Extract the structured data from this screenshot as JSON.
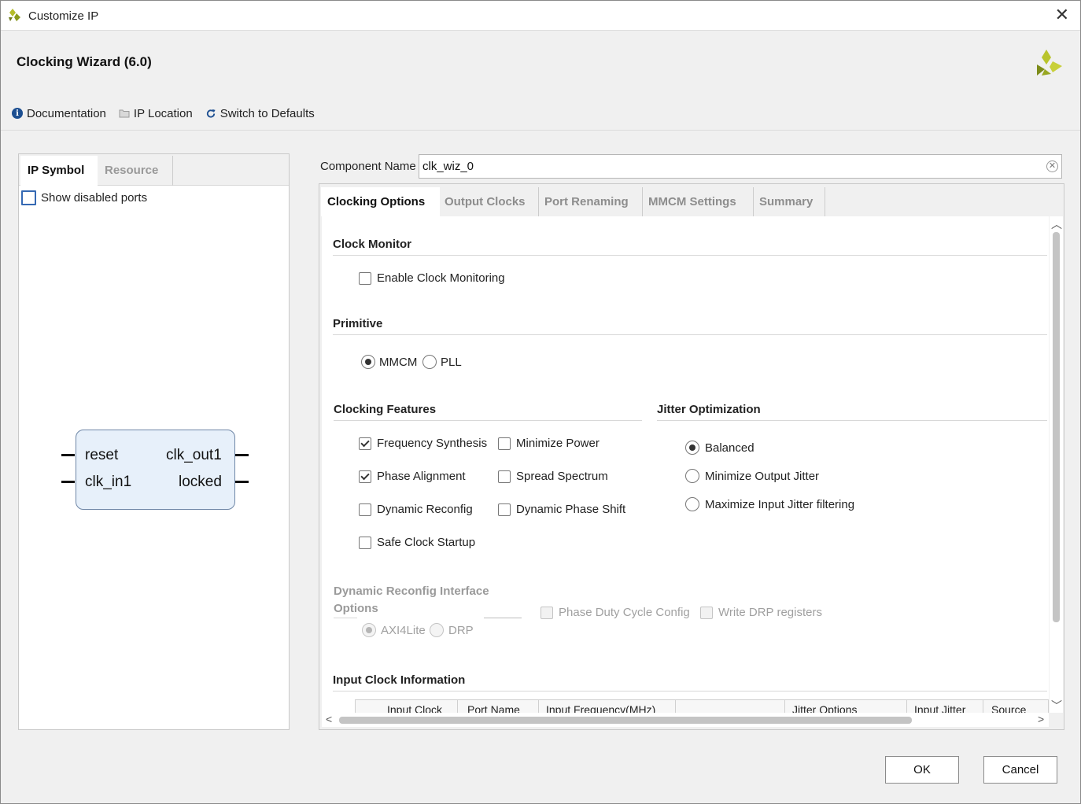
{
  "window": {
    "title": "Customize IP",
    "close_glyph": "✕"
  },
  "header": {
    "wizard_title": "Clocking Wizard (6.0)",
    "toolbar": [
      {
        "label": "Documentation",
        "icon": "info-icon"
      },
      {
        "label": "IP Location",
        "icon": "folder-icon"
      },
      {
        "label": "Switch to Defaults",
        "icon": "refresh-icon"
      }
    ]
  },
  "left_panel": {
    "tabs": [
      "IP Symbol",
      "Resource"
    ],
    "active_tab": "IP Symbol",
    "show_disabled_ports": {
      "label": "Show disabled ports",
      "checked": false
    },
    "symbol": {
      "inputs": [
        "reset",
        "clk_in1"
      ],
      "outputs": [
        "clk_out1",
        "locked"
      ]
    }
  },
  "component": {
    "label": "Component Name",
    "value": "clk_wiz_0"
  },
  "tabs": [
    "Clocking Options",
    "Output Clocks",
    "Port Renaming",
    "MMCM Settings",
    "Summary"
  ],
  "active_tab": "Clocking Options",
  "clock_monitor": {
    "title": "Clock Monitor",
    "enable": {
      "label": "Enable Clock Monitoring",
      "checked": false
    }
  },
  "primitive": {
    "title": "Primitive",
    "options": [
      {
        "label": "MMCM",
        "selected": true
      },
      {
        "label": "PLL",
        "selected": false
      }
    ]
  },
  "clocking_features": {
    "title": "Clocking Features",
    "items": [
      {
        "label": "Frequency Synthesis",
        "checked": true
      },
      {
        "label": "Minimize Power",
        "checked": false
      },
      {
        "label": "Phase Alignment",
        "checked": true
      },
      {
        "label": "Spread Spectrum",
        "checked": false
      },
      {
        "label": "Dynamic Reconfig",
        "checked": false
      },
      {
        "label": "Dynamic Phase Shift",
        "checked": false
      },
      {
        "label": "Safe Clock Startup",
        "checked": false
      }
    ]
  },
  "jitter": {
    "title": "Jitter Optimization",
    "options": [
      {
        "label": "Balanced",
        "selected": true
      },
      {
        "label": "Minimize Output Jitter",
        "selected": false
      },
      {
        "label": "Maximize Input Jitter filtering",
        "selected": false
      }
    ]
  },
  "dynamic_reconfig": {
    "title_line1": "Dynamic Reconfig Interface",
    "title_line2": "Options",
    "interface_options": [
      {
        "label": "AXI4Lite",
        "selected": true
      },
      {
        "label": "DRP",
        "selected": false
      }
    ],
    "phase_duty": {
      "label": "Phase Duty Cycle Config",
      "checked": false
    },
    "write_drp": {
      "label": "Write DRP registers",
      "checked": false
    }
  },
  "input_clock_info": {
    "title": "Input Clock Information",
    "columns": [
      "Input Clock",
      "Port Name",
      "Input Frequency(MHz)",
      "Jitter Options",
      "Input Jitter",
      "Source"
    ]
  },
  "buttons": {
    "ok": "OK",
    "cancel": "Cancel"
  }
}
